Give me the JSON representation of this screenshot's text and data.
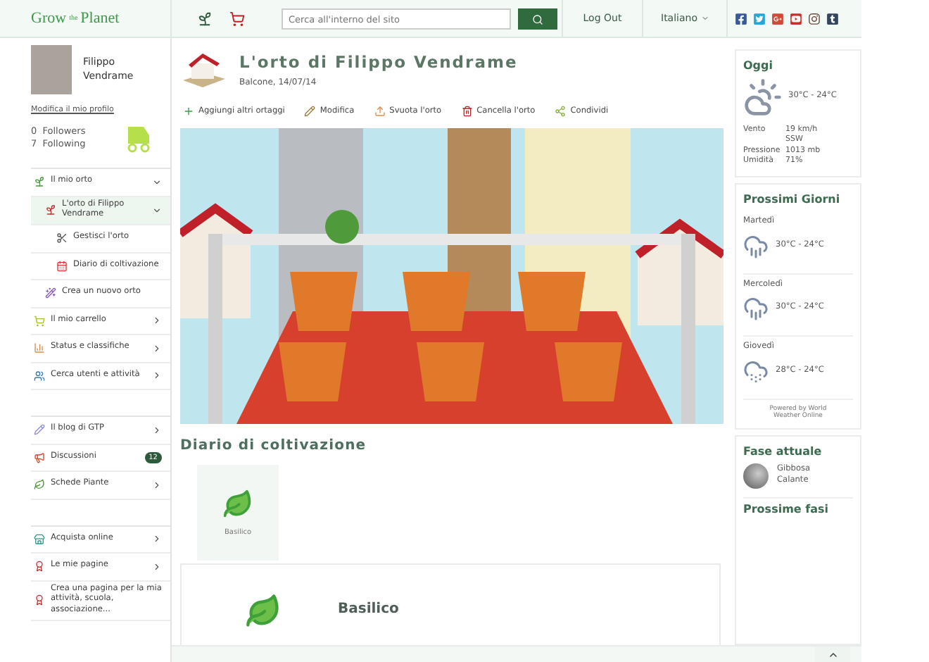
{
  "header": {
    "logo": {
      "first": "Grow",
      "middle": "the",
      "last": "Planet"
    },
    "search": {
      "placeholder": "Cerca all'interno del sito"
    },
    "logout": "Log Out",
    "language": "Italiano"
  },
  "profile": {
    "name": "Filippo Vendrame",
    "edit_link": "Modifica il mio profilo",
    "followers": "0  Followers",
    "following": "7  Following"
  },
  "nav_groups": [
    {
      "items": [
        {
          "label": "Il mio orto",
          "expanded": true,
          "selected": false,
          "arrow": false,
          "children": [
            {
              "label": "L'orto di Filippo Vendrame",
              "expanded": true,
              "selected": true,
              "children": [
                {
                  "label": "Gestisci l'orto"
                },
                {
                  "label": "Diario di coltivazione"
                }
              ]
            },
            {
              "label": "Crea un nuovo orto",
              "selected": false
            }
          ]
        },
        {
          "label": "Il mio carrello",
          "expanded": false,
          "selected": false,
          "arrow": true
        },
        {
          "label": "Status e classifiche",
          "expanded": false,
          "selected": false,
          "arrow": true
        },
        {
          "label": "Cerca utenti e attività",
          "expanded": false,
          "selected": false,
          "arrow": true
        }
      ]
    },
    {
      "items": [
        {
          "label": "Il blog di GTP",
          "expanded": false,
          "selected": false,
          "arrow": true
        },
        {
          "label": "Discussioni",
          "expanded": false,
          "selected": false,
          "arrow": false,
          "badge": "12"
        },
        {
          "label": "Schede Piante",
          "expanded": false,
          "selected": false,
          "arrow": true
        }
      ]
    },
    {
      "items": [
        {
          "label": "Acquista online",
          "expanded": false,
          "selected": false,
          "arrow": true
        },
        {
          "label": "Le mie pagine",
          "expanded": false,
          "selected": false,
          "arrow": true
        },
        {
          "label": "Crea una pagina per la mia attività, scuola, associazione...",
          "expanded": false,
          "selected": false,
          "arrow": false
        }
      ]
    }
  ],
  "garden": {
    "title": "L'orto di Filippo Vendrame",
    "subtitle": "Balcone, 14/07/14",
    "actions": [
      "Aggiungi altri ortaggi",
      "Modifica",
      "Svuota l'orto",
      "Cancella l'orto",
      "Condividi"
    ]
  },
  "diary": {
    "heading": "Diario di coltivazione",
    "plants": [
      {
        "name": "Basilico",
        "selected": true
      }
    ],
    "detail_title": "Basilico"
  },
  "weather": {
    "today": {
      "heading": "Oggi",
      "temp": "30°C - 24°C",
      "rows": [
        {
          "label": "Vento",
          "value": "19 km/h SSW"
        },
        {
          "label": "Pressione",
          "value": "1013 mb"
        },
        {
          "label": "Umidità",
          "value": "71%"
        }
      ]
    },
    "forecast": {
      "heading": "Prossimi Giorni",
      "days": [
        {
          "day": "Martedì",
          "temp": "30°C - 24°C",
          "kind": "rain"
        },
        {
          "day": "Mercoledì",
          "temp": "30°C - 24°C",
          "kind": "rain"
        },
        {
          "day": "Giovedì",
          "temp": "28°C - 24°C",
          "kind": "snow"
        }
      ],
      "credit": "Powered by World Weather Online"
    }
  },
  "moon": {
    "heading": "Fase attuale",
    "phase": "Gibbosa Calante",
    "next_heading": "Prossime fasi"
  }
}
